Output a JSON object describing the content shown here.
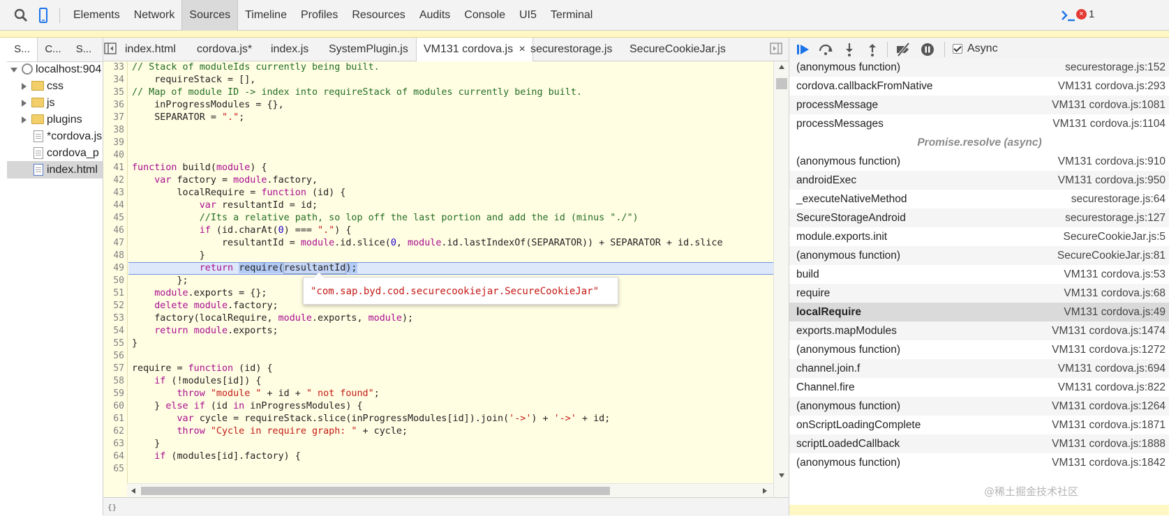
{
  "toolbar": {
    "panels": [
      "Elements",
      "Network",
      "Sources",
      "Timeline",
      "Profiles",
      "Resources",
      "Audits",
      "Console",
      "UI5",
      "Terminal"
    ],
    "active_panel": "Sources",
    "error_count": "1",
    "error_glyph": "×",
    "accent": "#1a73e8",
    "error_color": "#e53935"
  },
  "navigator": {
    "tabs": [
      "S...",
      "C...",
      "S..."
    ],
    "tree": [
      {
        "label": "localhost:904",
        "kind": "host"
      },
      {
        "label": "css",
        "kind": "folder"
      },
      {
        "label": "js",
        "kind": "folder"
      },
      {
        "label": "plugins",
        "kind": "folder"
      },
      {
        "label": "*cordova.js",
        "kind": "file"
      },
      {
        "label": "cordova_p",
        "kind": "file"
      },
      {
        "label": "index.html",
        "kind": "html"
      }
    ]
  },
  "editor": {
    "tabs": [
      "index.html",
      "cordova.js*",
      "index.js",
      "SystemPlugin.js",
      "VM131 cordova.js",
      "securestorage.js",
      "SecureCookieJar.js"
    ],
    "active_tab": "VM131 cordova.js",
    "close_glyph": "×",
    "line_numbers": [
      "33",
      "34",
      "35",
      "36",
      "37",
      "38",
      "39",
      "40",
      "41",
      "42",
      "43",
      "44",
      "45",
      "46",
      "47",
      "48",
      "49",
      "50",
      "51",
      "52",
      "53",
      "54",
      "55",
      "56",
      "57",
      "58",
      "59",
      "60",
      "61",
      "62",
      "63",
      "64",
      "65"
    ],
    "highlighted_line": "49",
    "tooltip": "\"com.sap.byd.cod.securecookiejar.SecureCookieJar\"",
    "code": {
      "l33": "// Stack of moduleIds currently being built.",
      "l34": "    requireStack = [],",
      "l35": "// Map of module ID -> index into requireStack of modules currently being built.",
      "l36": "    inProgressModules = {},",
      "l37a": "    SEPARATOR = ",
      "l37b": "\".\"",
      "l37c": ";",
      "l41a": "function",
      "l41b": " build(",
      "l41c": "module",
      "l41d": ") {",
      "l42a": "    ",
      "l42b": "var",
      "l42c": " factory = ",
      "l42d": "module",
      "l42e": ".factory,",
      "l43a": "        localRequire = ",
      "l43b": "function",
      "l43c": " (id) {",
      "l44a": "            ",
      "l44b": "var",
      "l44c": " resultantId = id;",
      "l45": "            //Its a relative path, so lop off the last portion and add the id (minus \"./\")",
      "l46a": "            ",
      "l46b": "if",
      "l46c": " (id.charAt(",
      "l46d": "0",
      "l46e": ") === ",
      "l46f": "\".\"",
      "l46g": ") {",
      "l47a": "                resultantId = ",
      "l47b": "module",
      "l47c": ".id.slice(",
      "l47d": "0",
      "l47e": ", ",
      "l47f": "module",
      "l47g": ".id.lastIndexOf(SEPARATOR)) + SEPARATOR + id.slice",
      "l48": "            }",
      "l49a": "            ",
      "l49b": "return",
      "l49c": " ",
      "l49d": "require(",
      "l49e": "resultantId",
      "l49f": ");",
      "l50": "        };",
      "l51a": "    ",
      "l51b": "module",
      "l51c": ".exports = {};",
      "l52a": "    ",
      "l52b": "delete",
      "l52c": " ",
      "l52d": "module",
      "l52e": ".factory;",
      "l53a": "    factory(localRequire, ",
      "l53b": "module",
      "l53c": ".exports, ",
      "l53d": "module",
      "l53e": ");",
      "l54a": "    ",
      "l54b": "return",
      "l54c": " ",
      "l54d": "module",
      "l54e": ".exports;",
      "l55": "}",
      "l57a": "require = ",
      "l57b": "function",
      "l57c": " (id) {",
      "l58a": "    ",
      "l58b": "if",
      "l58c": " (!modules[id]) {",
      "l59a": "        ",
      "l59b": "throw",
      "l59c": " ",
      "l59d": "\"module \"",
      "l59e": " + id + ",
      "l59f": "\" not found\"",
      "l59g": ";",
      "l60a": "    } ",
      "l60b": "else",
      "l60c": " ",
      "l60d": "if",
      "l60e": " (id ",
      "l60f": "in",
      "l60g": " inProgressModules) {",
      "l61a": "        ",
      "l61b": "var",
      "l61c": " cycle = requireStack.slice(inProgressModules[id]).join(",
      "l61d": "'->'",
      "l61e": ") + ",
      "l61f": "'->'",
      "l61g": " + id;",
      "l62a": "        ",
      "l62b": "throw",
      "l62c": " ",
      "l62d": "\"Cycle in require graph: \"",
      "l62e": " + cycle;",
      "l63": "    }",
      "l64a": "    ",
      "l64b": "if",
      "l64c": " (modules[id].factory) {"
    }
  },
  "debugger": {
    "async_label": "Async",
    "async_checked": true,
    "call_stack": [
      {
        "name": "(anonymous function)",
        "location": "securestorage.js:152"
      },
      {
        "name": "cordova.callbackFromNative",
        "location": "VM131 cordova.js:293"
      },
      {
        "name": "processMessage",
        "location": "VM131 cordova.js:1081"
      },
      {
        "name": "processMessages",
        "location": "VM131 cordova.js:1104"
      },
      {
        "name": "Promise.resolve (async)",
        "location": "",
        "separator": true
      },
      {
        "name": "(anonymous function)",
        "location": "VM131 cordova.js:910"
      },
      {
        "name": "androidExec",
        "location": "VM131 cordova.js:950"
      },
      {
        "name": "_executeNativeMethod",
        "location": "securestorage.js:64"
      },
      {
        "name": "SecureStorageAndroid",
        "location": "securestorage.js:127"
      },
      {
        "name": "module.exports.init",
        "location": "SecureCookieJar.js:5"
      },
      {
        "name": "(anonymous function)",
        "location": "SecureCookieJar.js:81"
      },
      {
        "name": "build",
        "location": "VM131 cordova.js:53"
      },
      {
        "name": "require",
        "location": "VM131 cordova.js:68"
      },
      {
        "name": "localRequire",
        "location": "VM131 cordova.js:49",
        "selected": true
      },
      {
        "name": "exports.mapModules",
        "location": "VM131 cordova.js:1474"
      },
      {
        "name": "(anonymous function)",
        "location": "VM131 cordova.js:1272"
      },
      {
        "name": "channel.join.f",
        "location": "VM131 cordova.js:694"
      },
      {
        "name": "Channel.fire",
        "location": "VM131 cordova.js:822"
      },
      {
        "name": "(anonymous function)",
        "location": "VM131 cordova.js:1264"
      },
      {
        "name": "onScriptLoadingComplete",
        "location": "VM131 cordova.js:1871"
      },
      {
        "name": "scriptLoadedCallback",
        "location": "VM131 cordova.js:1888"
      },
      {
        "name": "(anonymous function)",
        "location": "VM131 cordova.js:1842"
      }
    ]
  },
  "watermark": "@稀土掘金技术社区"
}
